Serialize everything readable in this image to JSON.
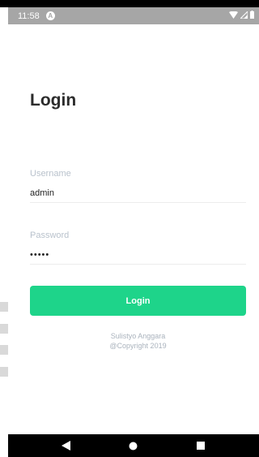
{
  "status_bar": {
    "time": "11:58",
    "notification_icon": "android-auto-icon",
    "wifi_icon": "wifi-icon",
    "signal_icon": "signal-icon",
    "battery_icon": "battery-icon",
    "color": "#a6a6a6"
  },
  "login": {
    "title": "Login",
    "username_label": "Username",
    "username_value": "admin",
    "password_label": "Password",
    "password_value": "•••••",
    "button_label": "Login",
    "accent_color": "#1ed48a"
  },
  "footer": {
    "author": "Sulistyo Anggara",
    "copyright": "@Copyright 2019"
  },
  "nav_bar": {
    "back_icon": "back-triangle-icon",
    "home_icon": "home-circle-icon",
    "recents_icon": "recents-square-icon"
  }
}
